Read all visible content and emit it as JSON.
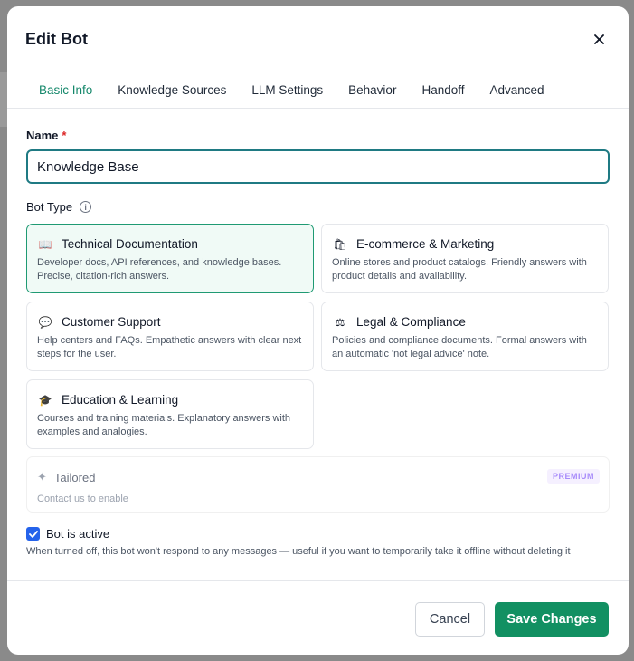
{
  "modal": {
    "title": "Edit Bot"
  },
  "tabs": [
    {
      "label": "Basic Info",
      "active": true
    },
    {
      "label": "Knowledge Sources",
      "active": false
    },
    {
      "label": "LLM Settings",
      "active": false
    },
    {
      "label": "Behavior",
      "active": false
    },
    {
      "label": "Handoff",
      "active": false
    },
    {
      "label": "Advanced",
      "active": false
    }
  ],
  "name_field": {
    "label": "Name",
    "required_mark": "*",
    "value": "Knowledge Base"
  },
  "bot_type": {
    "label": "Bot Type",
    "options": [
      {
        "icon": "book-icon",
        "glyph": "📖",
        "title": "Technical Documentation",
        "description": "Developer docs, API references, and knowledge bases. Precise, citation-rich answers.",
        "selected": true
      },
      {
        "icon": "shopping-bag-icon",
        "glyph": "🛍",
        "title": "E-commerce & Marketing",
        "description": "Online stores and product catalogs. Friendly answers with product details and availability.",
        "selected": false
      },
      {
        "icon": "speech-bubble-icon",
        "glyph": "💬",
        "title": "Customer Support",
        "description": "Help centers and FAQs. Empathetic answers with clear next steps for the user.",
        "selected": false
      },
      {
        "icon": "scales-icon",
        "glyph": "⚖",
        "title": "Legal & Compliance",
        "description": "Policies and compliance documents. Formal answers with an automatic 'not legal advice' note.",
        "selected": false
      },
      {
        "icon": "graduation-cap-icon",
        "glyph": "🎓",
        "title": "Education & Learning",
        "description": "Courses and training materials. Explanatory answers with examples and analogies.",
        "selected": false
      }
    ],
    "tailored": {
      "title": "Tailored",
      "description": "Contact us to enable",
      "badge": "PREMIUM"
    }
  },
  "active_toggle": {
    "label": "Bot is active",
    "checked": true,
    "help": "When turned off, this bot won't respond to any messages — useful if you want to temporarily take it offline without deleting it"
  },
  "footer": {
    "cancel_label": "Cancel",
    "save_label": "Save Changes"
  },
  "colors": {
    "accent": "#129062",
    "tab_active": "#14876a",
    "checkbox": "#2563eb",
    "premium_text": "#a78bfa"
  }
}
